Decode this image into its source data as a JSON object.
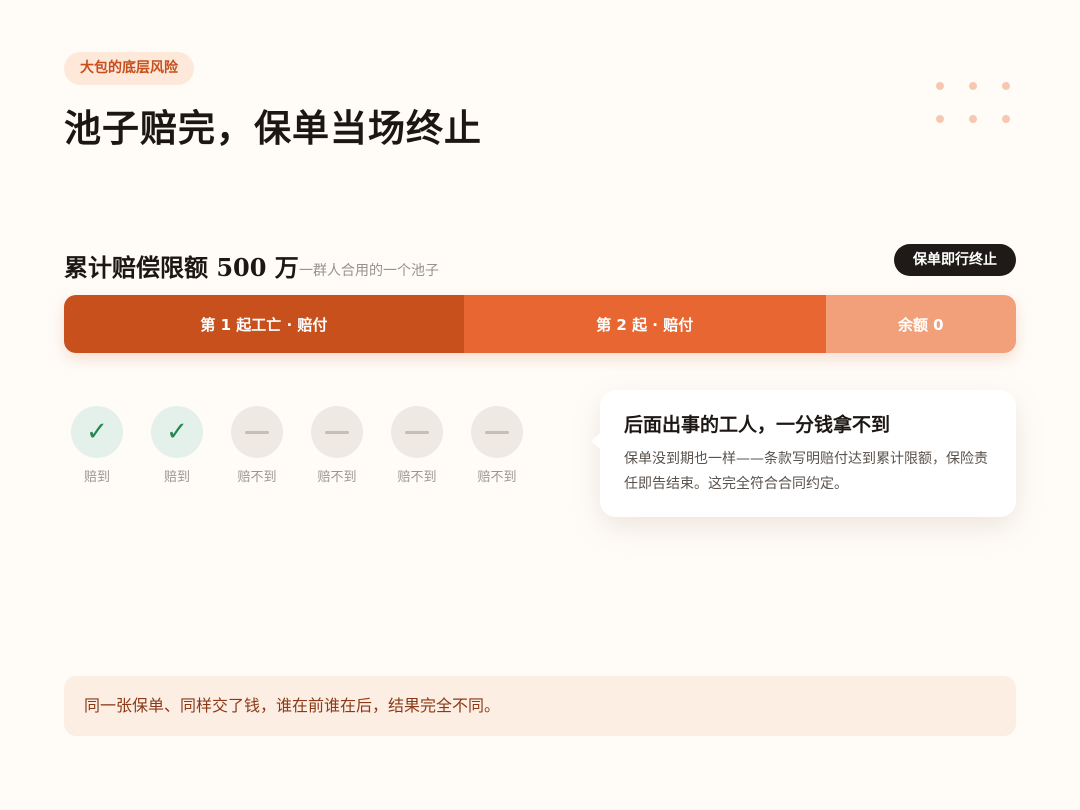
{
  "header": {
    "tag": "大包的底层风险",
    "title": "池子赔完，保单当场终止"
  },
  "limit": {
    "title": "累计赔偿限额 500 万",
    "subtitle": "一群人合用的一个池子",
    "badge": "保单即行终止"
  },
  "bar": {
    "segments": [
      {
        "label": "第 1 起工亡 · 赔付",
        "share": 0.42,
        "color": "#c8501c"
      },
      {
        "label": "第 2 起 · 赔付",
        "share": 0.38,
        "color": "#e86631"
      },
      {
        "label": "余额 0",
        "share": 0.2,
        "color": "#f2a07a"
      }
    ]
  },
  "workers": [
    {
      "status": "paid",
      "label": "赔到"
    },
    {
      "status": "paid",
      "label": "赔到"
    },
    {
      "status": "unpaid",
      "label": "赔不到"
    },
    {
      "status": "unpaid",
      "label": "赔不到"
    },
    {
      "status": "unpaid",
      "label": "赔不到"
    },
    {
      "status": "unpaid",
      "label": "赔不到"
    }
  ],
  "callout": {
    "title": "后面出事的工人，一分钱拿不到",
    "body": "保单没到期也一样——条款写明赔付达到累计限额，保险责任即告结束。这完全符合合同约定。"
  },
  "footer": {
    "text": "同一张保单、同样交了钱，谁在前谁在后，结果完全不同。"
  },
  "colors": {
    "accent": "#c8501c",
    "background": "#fffcf8",
    "paid": "#1f8a4c"
  },
  "icons": {
    "paid": "check-icon",
    "unpaid": "dash-icon"
  }
}
